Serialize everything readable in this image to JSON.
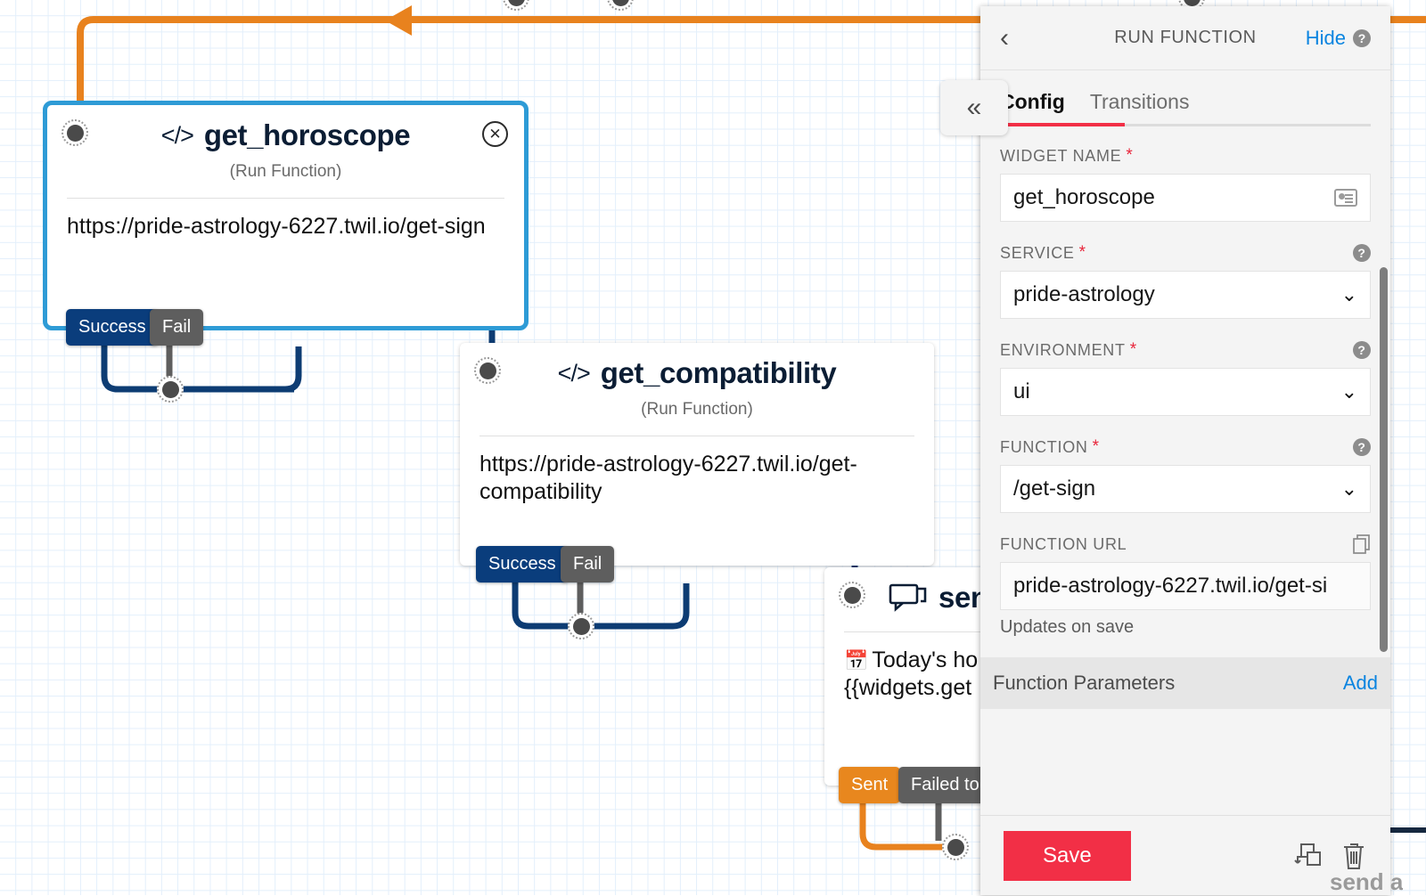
{
  "colors": {
    "accent_red": "#f22f46",
    "link_blue": "#0a84e0",
    "selected_border": "#2e9bd6",
    "success_navy": "#0a3d7c",
    "fail_gray": "#5e5e5e",
    "sent_orange": "#e8871e",
    "wire_orange": "#e8821e",
    "wire_navy": "#0d3c73",
    "grid_line": "#e3effb"
  },
  "canvas": {
    "collapse_button_label": "«",
    "nodes": [
      {
        "id": "get_horoscope",
        "title": "get_horoscope",
        "icon": "code-icon",
        "subtitle": "(Run Function)",
        "body": "https://pride-astrology-6227.twil.io/get-sign",
        "selected": true,
        "close_label": "✕",
        "transitions": [
          {
            "label": "Success",
            "kind": "success"
          },
          {
            "label": "Fail",
            "kind": "fail"
          }
        ]
      },
      {
        "id": "get_compatibility",
        "title": "get_compatibility",
        "icon": "code-icon",
        "subtitle": "(Run Function)",
        "body": "https://pride-astrology-6227.twil.io/get-compatibility",
        "selected": false,
        "transitions": [
          {
            "label": "Success",
            "kind": "success"
          },
          {
            "label": "Fail",
            "kind": "fail"
          }
        ]
      },
      {
        "id": "send_message",
        "title": "sen",
        "icon": "chat-bubble-icon",
        "subtitle": "",
        "body_emoji": "📅",
        "body_line1": "Today's ho",
        "body_line2": "{{widgets.get",
        "selected": false,
        "transitions": [
          {
            "label": "Sent",
            "kind": "sent"
          },
          {
            "label": "Failed to S",
            "kind": "fail"
          }
        ]
      }
    ],
    "clipped_bottom_text": "send a"
  },
  "panel": {
    "header": {
      "back_label": "‹",
      "title": "RUN FUNCTION",
      "hide_label": "Hide",
      "help_label": "?"
    },
    "tabs": [
      {
        "label": "Config",
        "active": true
      },
      {
        "label": "Transitions",
        "active": false
      }
    ],
    "fields": [
      {
        "label": "WIDGET NAME",
        "required": true,
        "value": "get_horoscope",
        "control": "text",
        "trailing_icon": "contact-card-icon"
      },
      {
        "label": "SERVICE",
        "required": true,
        "value": "pride-astrology",
        "control": "select",
        "help": "?"
      },
      {
        "label": "ENVIRONMENT",
        "required": true,
        "value": "ui",
        "control": "select",
        "help": "?"
      },
      {
        "label": "FUNCTION",
        "required": true,
        "value": "/get-sign",
        "control": "select",
        "help": "?"
      },
      {
        "label": "FUNCTION URL",
        "required": false,
        "value": "pride-astrology-6227.twil.io/get-si",
        "control": "readonly",
        "trailing_icon": "copy-icon",
        "hint": "Updates on save"
      }
    ],
    "parameters": {
      "label": "Function Parameters",
      "add_label": "Add"
    },
    "footer": {
      "save_label": "Save",
      "duplicate_icon": "duplicate-icon",
      "delete_icon": "trash-icon"
    }
  }
}
